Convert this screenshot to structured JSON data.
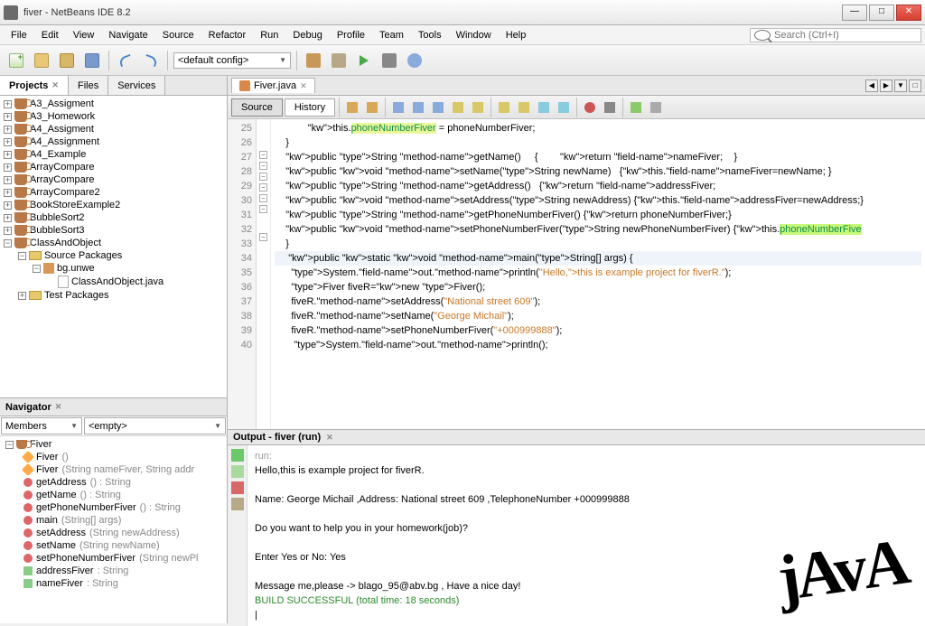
{
  "window": {
    "title": "fiver - NetBeans IDE 8.2"
  },
  "menubar": [
    "File",
    "Edit",
    "View",
    "Navigate",
    "Source",
    "Refactor",
    "Run",
    "Debug",
    "Profile",
    "Team",
    "Tools",
    "Window",
    "Help"
  ],
  "search_placeholder": "Search (Ctrl+I)",
  "config": "<default config>",
  "panels": {
    "projects": "Projects",
    "files": "Files",
    "services": "Services"
  },
  "projects": [
    "A3_Assigment",
    "A3_Homework",
    "A4_Assigment",
    "A4_Assignment",
    "A4_Example",
    "ArrayCompare",
    "ArrayCompare",
    "ArrayCompare2",
    "BookStoreExample2",
    "BubbleSort2",
    "BubbleSort3"
  ],
  "project_open": {
    "name": "ClassAndObject",
    "src": "Source Packages",
    "pkg": "bg.unwe",
    "file": "ClassAndObject.java",
    "test": "Test Packages"
  },
  "navigator": {
    "title": "Navigator",
    "members_label": "Members",
    "empty_label": "<empty>",
    "class": "Fiver",
    "members": [
      {
        "t": "ctor",
        "n": "Fiver",
        "sig": "()"
      },
      {
        "t": "ctor",
        "n": "Fiver",
        "sig": "(String nameFiver, String addr"
      },
      {
        "t": "method",
        "n": "getAddress",
        "sig": "() : String"
      },
      {
        "t": "method",
        "n": "getName",
        "sig": "() : String"
      },
      {
        "t": "method",
        "n": "getPhoneNumberFiver",
        "sig": "() : String"
      },
      {
        "t": "method",
        "n": "main",
        "sig": "(String[] args)"
      },
      {
        "t": "method",
        "n": "setAddress",
        "sig": "(String newAddress)"
      },
      {
        "t": "method",
        "n": "setName",
        "sig": "(String newName)"
      },
      {
        "t": "method",
        "n": "setPhoneNumberFiver",
        "sig": "(String newPl"
      },
      {
        "t": "field",
        "n": "addressFiver",
        "sig": " : String"
      },
      {
        "t": "field",
        "n": "nameFiver",
        "sig": " : String"
      }
    ]
  },
  "editor": {
    "filename": "Fiver.java",
    "source_btn": "Source",
    "history_btn": "History",
    "lines": {
      "start": 25,
      "content": [
        "            this.phoneNumberFiver = phoneNumberFiver;",
        "    }",
        "    public String getName()     {        return nameFiver;    }",
        "    public void setName(String newName)   {this.nameFiver=newName; }",
        "    public String getAddress()   {return addressFiver;",
        "    public void setAddress(String newAddress) {this.addressFiver=newAddress;}",
        "    public String getPhoneNumberFiver() {return phoneNumberFiver;}",
        "    public void setPhoneNumberFiver(String newPhoneNumberFiver) {this.phoneNumberFiver",
        "    }",
        "     public static void main(String[] args) {",
        "      System.out.println(\"Hello,this is example project for fiverR.\");",
        "      Fiver fiveR=new Fiver();",
        "      fiveR.setAddress(\"National street 609\");",
        "      fiveR.setName(\"George Michail\");",
        "      fiveR.setPhoneNumberFiver(\"+000999888\");",
        "       System.out.println();"
      ]
    }
  },
  "output": {
    "title": "Output - fiver (run)",
    "lines": [
      {
        "c": "gray",
        "t": "run:"
      },
      {
        "c": "",
        "t": "Hello,this is example project for fiverR."
      },
      {
        "c": "",
        "t": ""
      },
      {
        "c": "",
        "t": "Name: George Michail ,Address: National street 609 ,TelephoneNumber +000999888"
      },
      {
        "c": "",
        "t": ""
      },
      {
        "c": "",
        "t": "Do you want to help you in your homework(job)?"
      },
      {
        "c": "",
        "t": ""
      },
      {
        "c": "",
        "t": "Enter Yes or No: Yes"
      },
      {
        "c": "",
        "t": ""
      },
      {
        "c": "",
        "t": "Message me,please -> blago_95@abv.bg , Have a nice day!"
      },
      {
        "c": "green",
        "t": "BUILD SUCCESSFUL (total time: 18 seconds)"
      }
    ]
  }
}
